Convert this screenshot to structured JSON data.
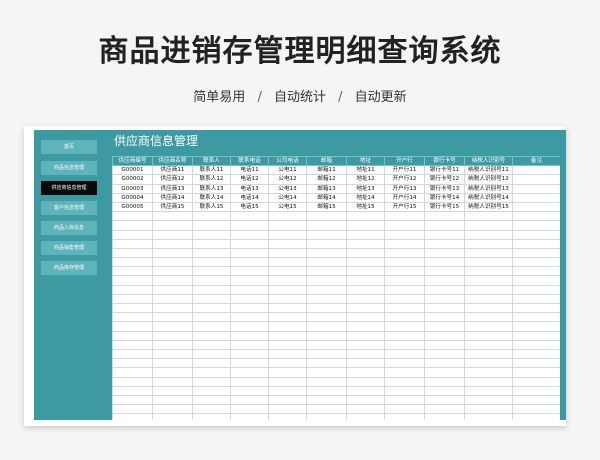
{
  "page": {
    "title": "商品进销存管理明细查询系统",
    "subtitle_parts": [
      "简单易用",
      "自动统计",
      "自动更新"
    ],
    "separator": "/"
  },
  "colors": {
    "accent": "#3d9aa3",
    "nav_button": "#5fb3ba",
    "nav_active": "#0a0a0a",
    "header_text": "#ffffff"
  },
  "sidebar": {
    "items": [
      {
        "label": "首页",
        "active": false
      },
      {
        "label": "商品信息管理",
        "active": false
      },
      {
        "label": "供应商信息管理",
        "active": true
      },
      {
        "label": "客户信息管理",
        "active": false
      },
      {
        "label": "商品入库信息",
        "active": false
      },
      {
        "label": "商品销售管理",
        "active": false
      },
      {
        "label": "商品库存管理",
        "active": false
      }
    ]
  },
  "main": {
    "title": "供应商信息管理",
    "columns": [
      "供应商编号",
      "供应商名称",
      "联系人",
      "联系电话",
      "公司电话",
      "邮箱",
      "地址",
      "开户行",
      "银行卡号",
      "纳税人识别号",
      "备注"
    ],
    "rows": [
      [
        "G00001",
        "供应商11",
        "联系人11",
        "电话11",
        "公电11",
        "邮箱11",
        "地址11",
        "开户行11",
        "银行卡号11",
        "纳税人识别号11",
        ""
      ],
      [
        "G00002",
        "供应商12",
        "联系人12",
        "电话12",
        "公电12",
        "邮箱12",
        "地址12",
        "开户行12",
        "银行卡号12",
        "纳税人识别号12",
        ""
      ],
      [
        "G00003",
        "供应商13",
        "联系人13",
        "电话13",
        "公电13",
        "邮箱13",
        "地址13",
        "开户行13",
        "银行卡号13",
        "纳税人识别号13",
        ""
      ],
      [
        "G00004",
        "供应商14",
        "联系人14",
        "电话14",
        "公电14",
        "邮箱14",
        "地址14",
        "开户行14",
        "银行卡号14",
        "纳税人识别号14",
        ""
      ],
      [
        "G00005",
        "供应商15",
        "联系人15",
        "电话15",
        "公电15",
        "邮箱15",
        "地址15",
        "开户行15",
        "银行卡号15",
        "纳税人识别号15",
        ""
      ]
    ]
  }
}
